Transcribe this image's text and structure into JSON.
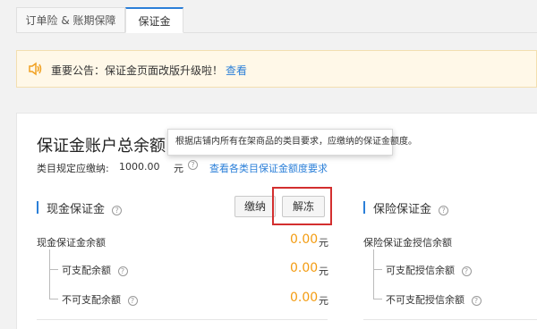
{
  "tabs": [
    {
      "label": "订单险 & 账期保障"
    },
    {
      "label": "保证金"
    }
  ],
  "notice": {
    "text": "重要公告：保证金页面改版升级啦！",
    "link": "查看"
  },
  "account": {
    "title": "保证金账户总余额",
    "tooltip": "根据店铺内所有在架商品的类目要求，应缴纳的保证金额度。",
    "required_label": "类目规定应缴纳:",
    "required_value": "1000.00",
    "required_unit": "元",
    "required_link": "查看各类目保证金额度要求"
  },
  "cash": {
    "title": "现金保证金",
    "pay_button": "缴纳",
    "unfreeze_button": "解冻",
    "balance_label": "现金保证金余额",
    "balance_value": "0.00",
    "available_label": "可支配余额",
    "available_value": "0.00",
    "unavailable_label": "不可支配余额",
    "unavailable_value": "0.00",
    "unit": "元"
  },
  "insurance": {
    "title": "保险保证金",
    "credit_label": "保险保证金授信余额",
    "available_label": "可支配授信余额",
    "unavailable_label": "不可支配授信余额"
  },
  "colors": {
    "accent": "#2b7fd8",
    "amount": "#f39c12",
    "highlight_box": "#d32f2f"
  }
}
